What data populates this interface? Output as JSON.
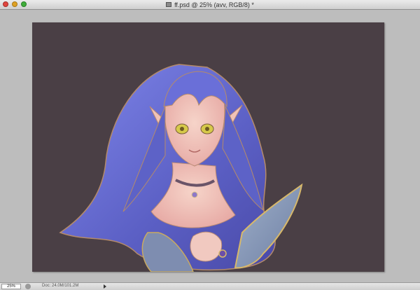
{
  "window": {
    "title": "ff.psd @ 25% (avv, RGB/8) *"
  },
  "statusbar": {
    "zoom": "25%",
    "doc_info": "Doc: 24.0M/101.2M"
  },
  "colors": {
    "canvas_background": "#4a3f45",
    "hair": "#6f73d6",
    "workspace": "#bdbdbd"
  },
  "icons": {
    "close": "close-icon",
    "minimize": "minimize-icon",
    "zoom": "zoom-icon",
    "document": "document-icon",
    "status": "status-icon",
    "menu": "status-menu-arrow-icon"
  },
  "canvas": {
    "content": "painted illustration of an elf girl with long blue hair"
  }
}
